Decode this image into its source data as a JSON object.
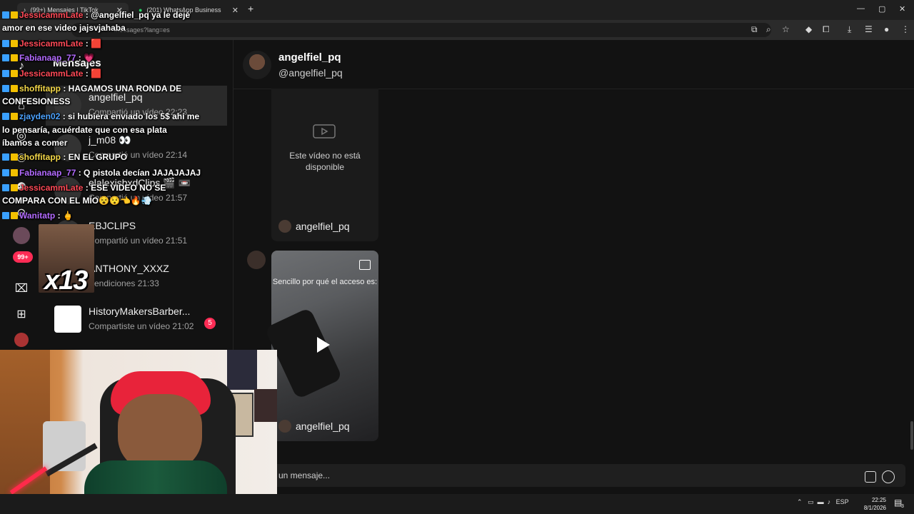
{
  "browser": {
    "tabs": [
      {
        "title": "(99+) Mensajes | TikTok",
        "active": true
      },
      {
        "title": "(201) WhatsApp Business",
        "active": false
      }
    ],
    "url_visible": "messages?lang=es"
  },
  "sidebar": {
    "title": "Mensajes",
    "unread_badge": "99+",
    "conversations": [
      {
        "name": "angelfiel_pq",
        "preview": "Compartió un vídeo 22:23",
        "active": true
      },
      {
        "name": "j_m08 👀",
        "preview": "Compartió un vídeo 22:14"
      },
      {
        "name": "elalexisbxdClips 🎬 📼",
        "preview": "Compartió un vídeo 21:57"
      },
      {
        "name": "EBJCLIPS",
        "preview": "Compartió un vídeo 21:51"
      },
      {
        "name": "ANTHONY_XXXZ",
        "preview": "Bendiciones 21:33"
      },
      {
        "name": "HistoryMakersBarber...",
        "preview": "Compartiste un vídeo 21:02",
        "badge": "5"
      }
    ]
  },
  "chat": {
    "header_name": "angelfiel_pq",
    "header_handle": "@angelfiel_pq",
    "unavailable_text": "Este vídeo no está disponible",
    "card1_author": "angelfiel_pq",
    "card2_caption": "Sencillo por qué el acceso es:",
    "card2_author": "angelfiel_pq",
    "input_placeholder": "un mensaje..."
  },
  "stream_chat": [
    {
      "user": "JessicammLate",
      "text": ": @angelfiel_pq ya le dejé",
      "ucolor": "u-red"
    },
    {
      "user": "",
      "text": "amor en ese video jajsvjahaba",
      "ucolor": ""
    },
    {
      "user": "JessicammLate",
      "text": ": 🟥",
      "ucolor": "u-red"
    },
    {
      "user": "Fabianaap_77",
      "text": ": 💗",
      "ucolor": "u-pur"
    },
    {
      "user": "JessicammLate",
      "text": ": 🟥",
      "ucolor": "u-red"
    },
    {
      "user": "shoffitapp",
      "text": ": HAGAMOS UNA RONDA DE",
      "ucolor": "u-yel"
    },
    {
      "user": "",
      "text": "CONFESIONESS",
      "ucolor": ""
    },
    {
      "user": "zjayden02",
      "text": ": si hubiera enviado los 5$ ahí me",
      "ucolor": "u-blu"
    },
    {
      "user": "",
      "text": "lo pensaría, acuérdate que con esa plata",
      "ucolor": ""
    },
    {
      "user": "",
      "text": "íbamos a comer",
      "ucolor": ""
    },
    {
      "user": "shoffitapp",
      "text": ": EN EL GRUPO",
      "ucolor": "u-yel"
    },
    {
      "user": "Fabianaap_77",
      "text": ": Q pistola decían JAJAJAJAJ",
      "ucolor": "u-pur"
    },
    {
      "user": "JessicammLate",
      "text": ": ESE VIDEO NO SE",
      "ucolor": "u-red"
    },
    {
      "user": "",
      "text": "COMPARA CON EL MÍO😵😯👈🔥💨",
      "ucolor": ""
    },
    {
      "user": "Wanitatp",
      "text": ": 🖕",
      "ucolor": "u-pur"
    }
  ],
  "overlay": {
    "multiplier": "x13"
  },
  "taskbar": {
    "lang": "ESP",
    "time": "22:25",
    "date": "8/1/2026",
    "notif": "3"
  }
}
